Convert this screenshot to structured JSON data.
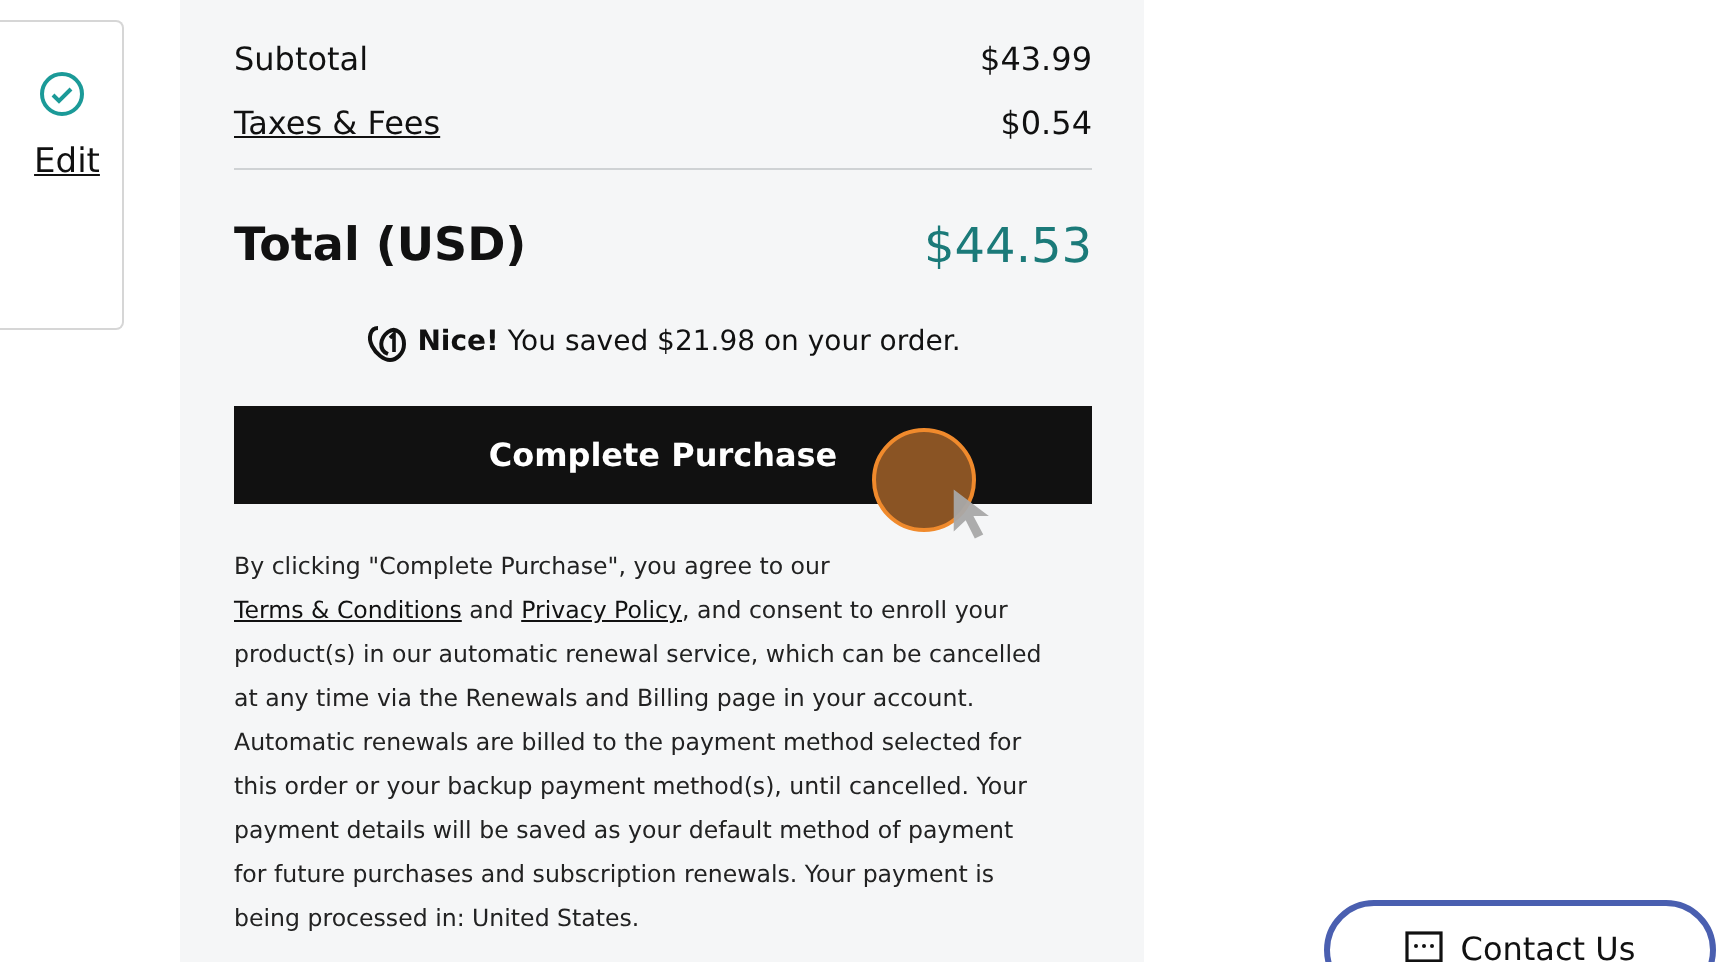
{
  "side_card": {
    "edit_link": "Edit"
  },
  "summary": {
    "rows": [
      {
        "label": "Subtotal",
        "value": "$43.99",
        "link": false
      },
      {
        "label": "Taxes & Fees",
        "value": "$0.54",
        "link": true
      }
    ],
    "total_label": "Total (USD)",
    "total_value": "$44.53",
    "savings": "**Nice!** You saved $21.98 on your order.",
    "button": "Complete Purchase",
    "legal": [
      {
        "text": "By clicking \"Complete Purchase\", you agree to our ",
        "link": false
      },
      {
        "text": "Terms & Conditions",
        "link": true
      },
      {
        "text": " and ",
        "link": false
      },
      {
        "text": "Privacy Policy",
        "link": true
      },
      {
        "text": ", and consent to enroll your product(s) in our automatic renewal service, which can be cancelled at any time via the Renewals and Billing page in your account. Automatic renewals are billed to the payment method selected for this order or your backup payment method(s), until cancelled. Your payment details will be saved as your default method of payment for future purchases and subscription renewals. Your payment is being processed in: United States.",
        "link": false
      }
    ]
  },
  "contact_button": "Contact Us"
}
